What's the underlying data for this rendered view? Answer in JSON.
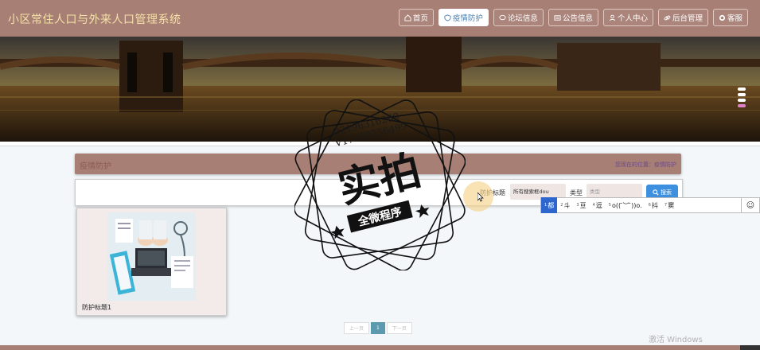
{
  "header": {
    "site_title": "小区常住人口与外来人口管理系统",
    "nav": [
      {
        "label": "首页",
        "icon": "home-icon",
        "active": false
      },
      {
        "label": "疫情防护",
        "icon": "shield-icon",
        "active": true
      },
      {
        "label": "论坛信息",
        "icon": "chat-icon",
        "active": false
      },
      {
        "label": "公告信息",
        "icon": "announcement-icon",
        "active": false
      },
      {
        "label": "个人中心",
        "icon": "user-icon",
        "active": false
      },
      {
        "label": "后台管理",
        "icon": "link-icon",
        "active": false
      },
      {
        "label": "客服",
        "icon": "headset-icon",
        "active": false
      }
    ]
  },
  "section": {
    "title": "疫情防护",
    "breadcrumb": "您现在的位置：疫情防护"
  },
  "search": {
    "title_label": "防护标题",
    "title_value": "所有搜索框dou",
    "type_label": "类型",
    "type_placeholder": "类型",
    "button_label": "搜索"
  },
  "cards": [
    {
      "title": "防护标题1"
    }
  ],
  "pagination": {
    "prev": "上一页",
    "current": "1",
    "next": "下一页"
  },
  "ime": {
    "candidates": [
      {
        "num": "1",
        "text": "都"
      },
      {
        "num": "2",
        "text": "斗"
      },
      {
        "num": "3",
        "text": "豆"
      },
      {
        "num": "4",
        "text": "逗"
      },
      {
        "num": "5",
        "text": "o(( ̄︶ ̄))o."
      },
      {
        "num": "6",
        "text": "抖"
      },
      {
        "num": "7",
        "text": "窦"
      }
    ],
    "emoji_symbol": "☺"
  },
  "watermark": {
    "qq": "Q2196316269",
    "wx": "V17060256499",
    "main": "实拍",
    "sub": "全微程序"
  },
  "os_notice": "激活 Windows",
  "colors": {
    "header_bg": "#a77f74",
    "accent_blue": "#3d8fe0",
    "title_gold": "#f4e0a8"
  }
}
